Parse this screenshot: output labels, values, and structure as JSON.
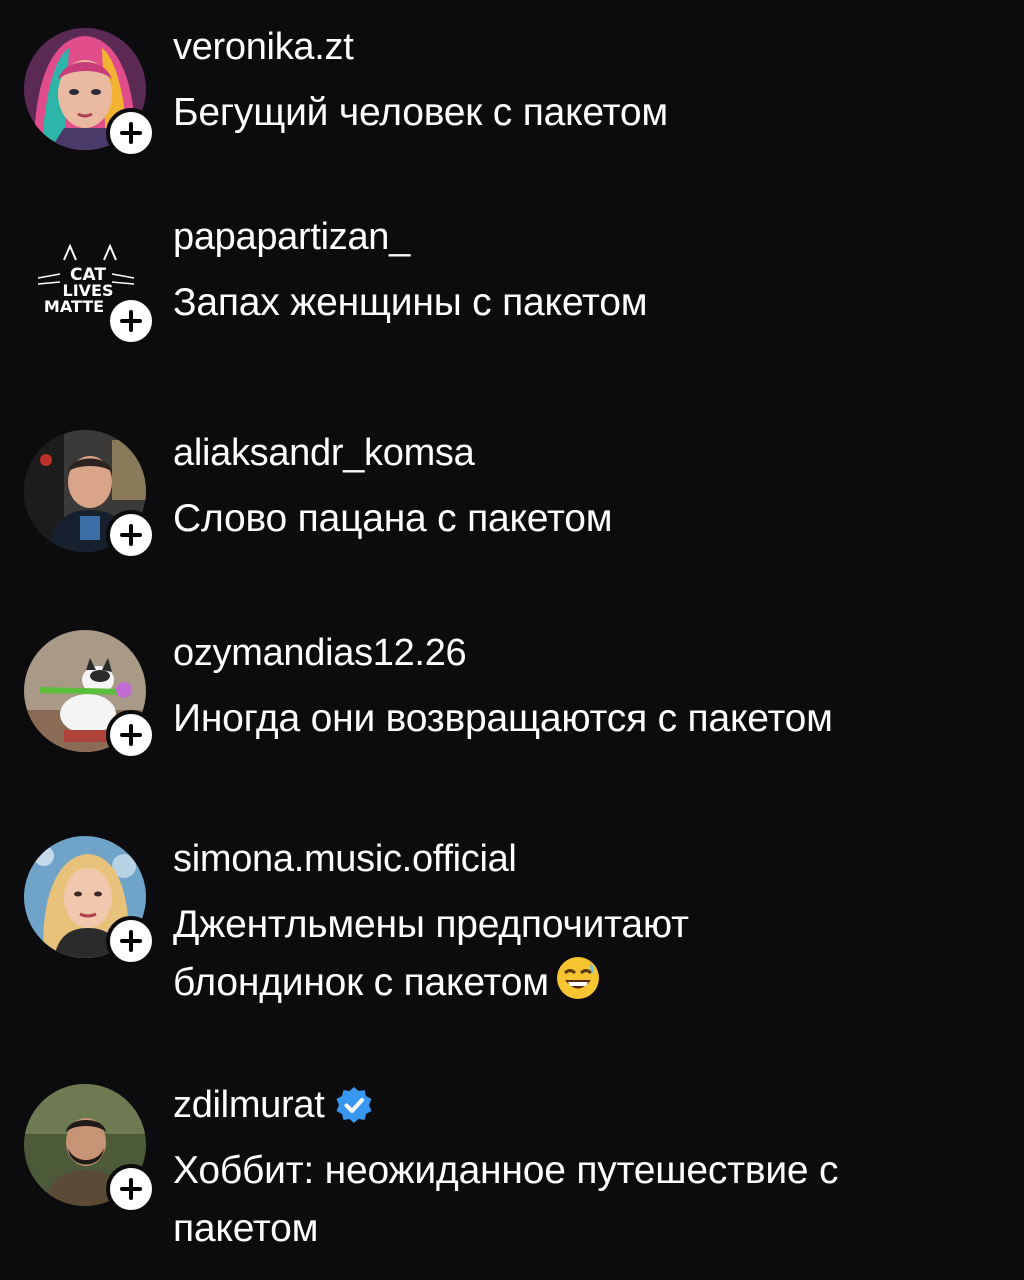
{
  "comments": [
    {
      "username": "veronika.zt",
      "text": "Бегущий человек с пакетом",
      "avatar": "avatar-woman-colorful-hair"
    },
    {
      "username": "papapartizan_",
      "text": "Запах женщины с пакетом",
      "avatar": "avatar-cat-lives-matter",
      "avatar_text": [
        "CAT",
        "LIVES",
        "MATTE"
      ]
    },
    {
      "username": "aliaksandr_komsa",
      "text": "Слово пацана с пакетом",
      "avatar": "avatar-man-photo"
    },
    {
      "username": "ozymandias12.26",
      "text": "Иногда они возвращаются с пакетом",
      "avatar": "avatar-cat-with-flower"
    },
    {
      "username": "simona.music.official",
      "text_line1": "Джентльмены предпочитают",
      "text_line2": "блондинок с пакетом",
      "emoji": "grinning-sweat-emoji",
      "avatar": "avatar-woman-blonde"
    },
    {
      "username": "zdilmurat",
      "verified": true,
      "text_line1": "Хоббит: неожиданное путешествие с",
      "text_line2": "пакетом",
      "avatar": "avatar-bearded-man"
    }
  ],
  "colors": {
    "background": "#0c0c0e",
    "text": "#ffffff",
    "verified": "#3897f0"
  }
}
